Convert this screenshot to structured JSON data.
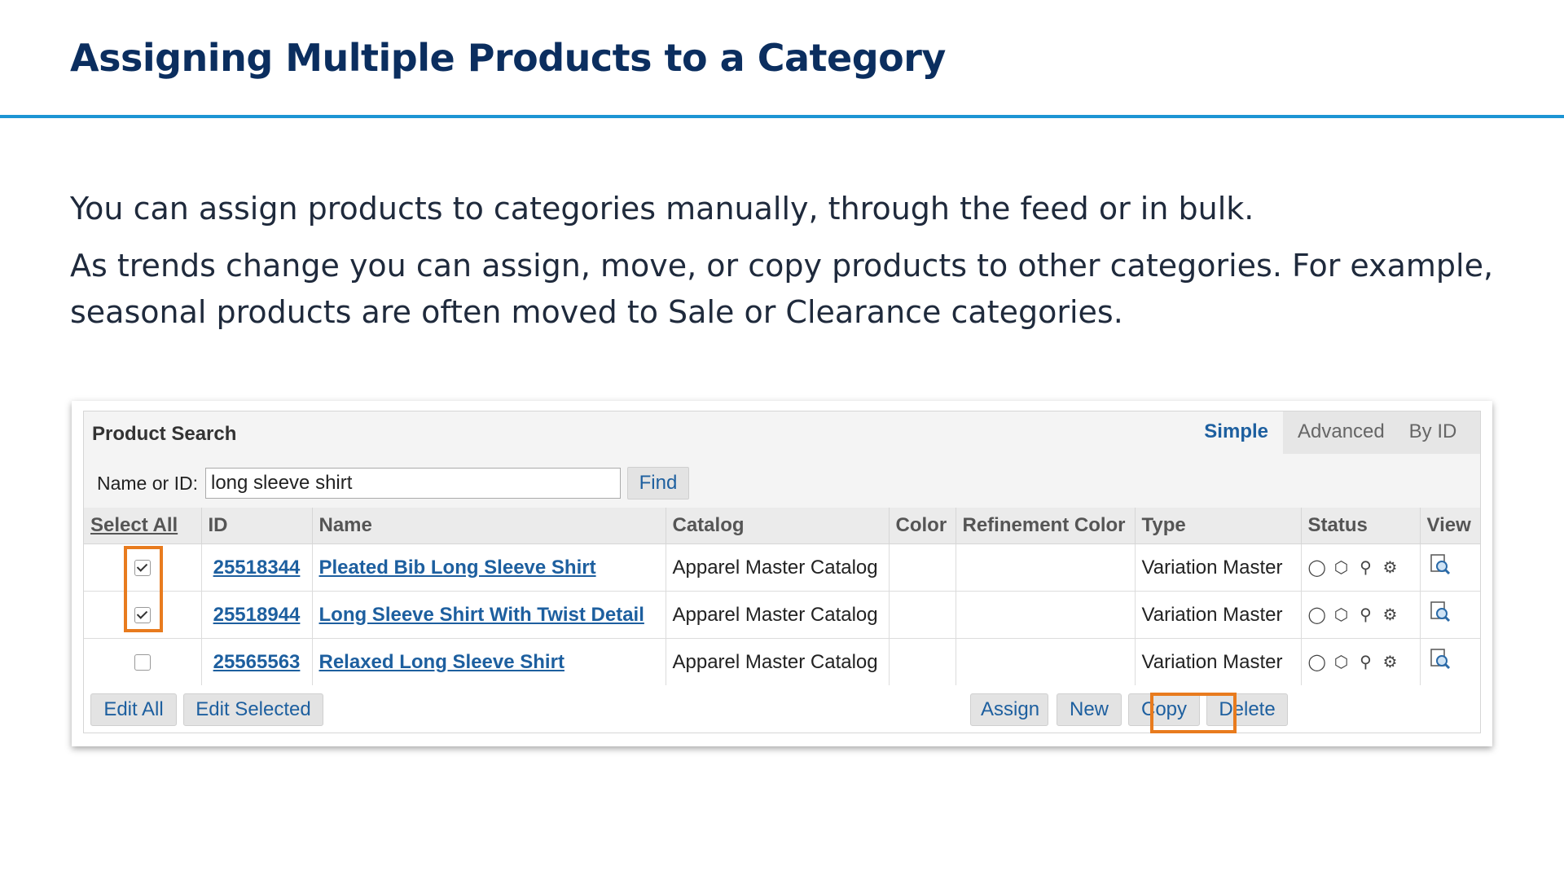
{
  "slide": {
    "title": "Assigning Multiple Products to a Category",
    "paragraphs": [
      "You can assign products to categories manually, through the feed or in bulk.",
      "As trends change you can assign, move, or copy products to other categories. For example, seasonal products are often moved to Sale or Clearance categories."
    ]
  },
  "search": {
    "panel_title": "Product Search",
    "tabs": [
      {
        "label": "Simple",
        "active": true
      },
      {
        "label": "Advanced",
        "active": false
      },
      {
        "label": "By ID",
        "active": false
      }
    ],
    "field_label": "Name or ID:",
    "query": "long sleeve shirt",
    "find_label": "Find"
  },
  "table": {
    "headers": {
      "select": "Select All",
      "id": "ID",
      "name": "Name",
      "catalog": "Catalog",
      "color": "Color",
      "refinement": "Refinement Color",
      "type": "Type",
      "status": "Status",
      "view": "View"
    },
    "rows": [
      {
        "checked": true,
        "id": "25518344",
        "name": "Pleated Bib Long Sleeve Shirt",
        "catalog": "Apparel Master Catalog",
        "color": "",
        "refinement": "",
        "type": "Variation Master"
      },
      {
        "checked": true,
        "id": "25518944",
        "name": "Long Sleeve Shirt With Twist Detail",
        "catalog": "Apparel Master Catalog",
        "color": "",
        "refinement": "",
        "type": "Variation Master"
      },
      {
        "checked": false,
        "id": "25565563",
        "name": "Relaxed Long Sleeve Shirt",
        "catalog": "Apparel Master Catalog",
        "color": "",
        "refinement": "",
        "type": "Variation Master"
      }
    ],
    "status_icons": [
      "online-status-icon",
      "box-icon",
      "search-status-icon",
      "category-assignment-icon"
    ],
    "view_icon": "view-details-icon"
  },
  "actions": {
    "edit_all": "Edit All",
    "edit_selected": "Edit Selected",
    "assign": "Assign",
    "new": "New",
    "copy": "Copy",
    "delete": "Delete"
  },
  "colors": {
    "title": "#0b2e5f",
    "rule": "#1c95d4",
    "link": "#1d5f9f",
    "highlight": "#e87b1e"
  }
}
